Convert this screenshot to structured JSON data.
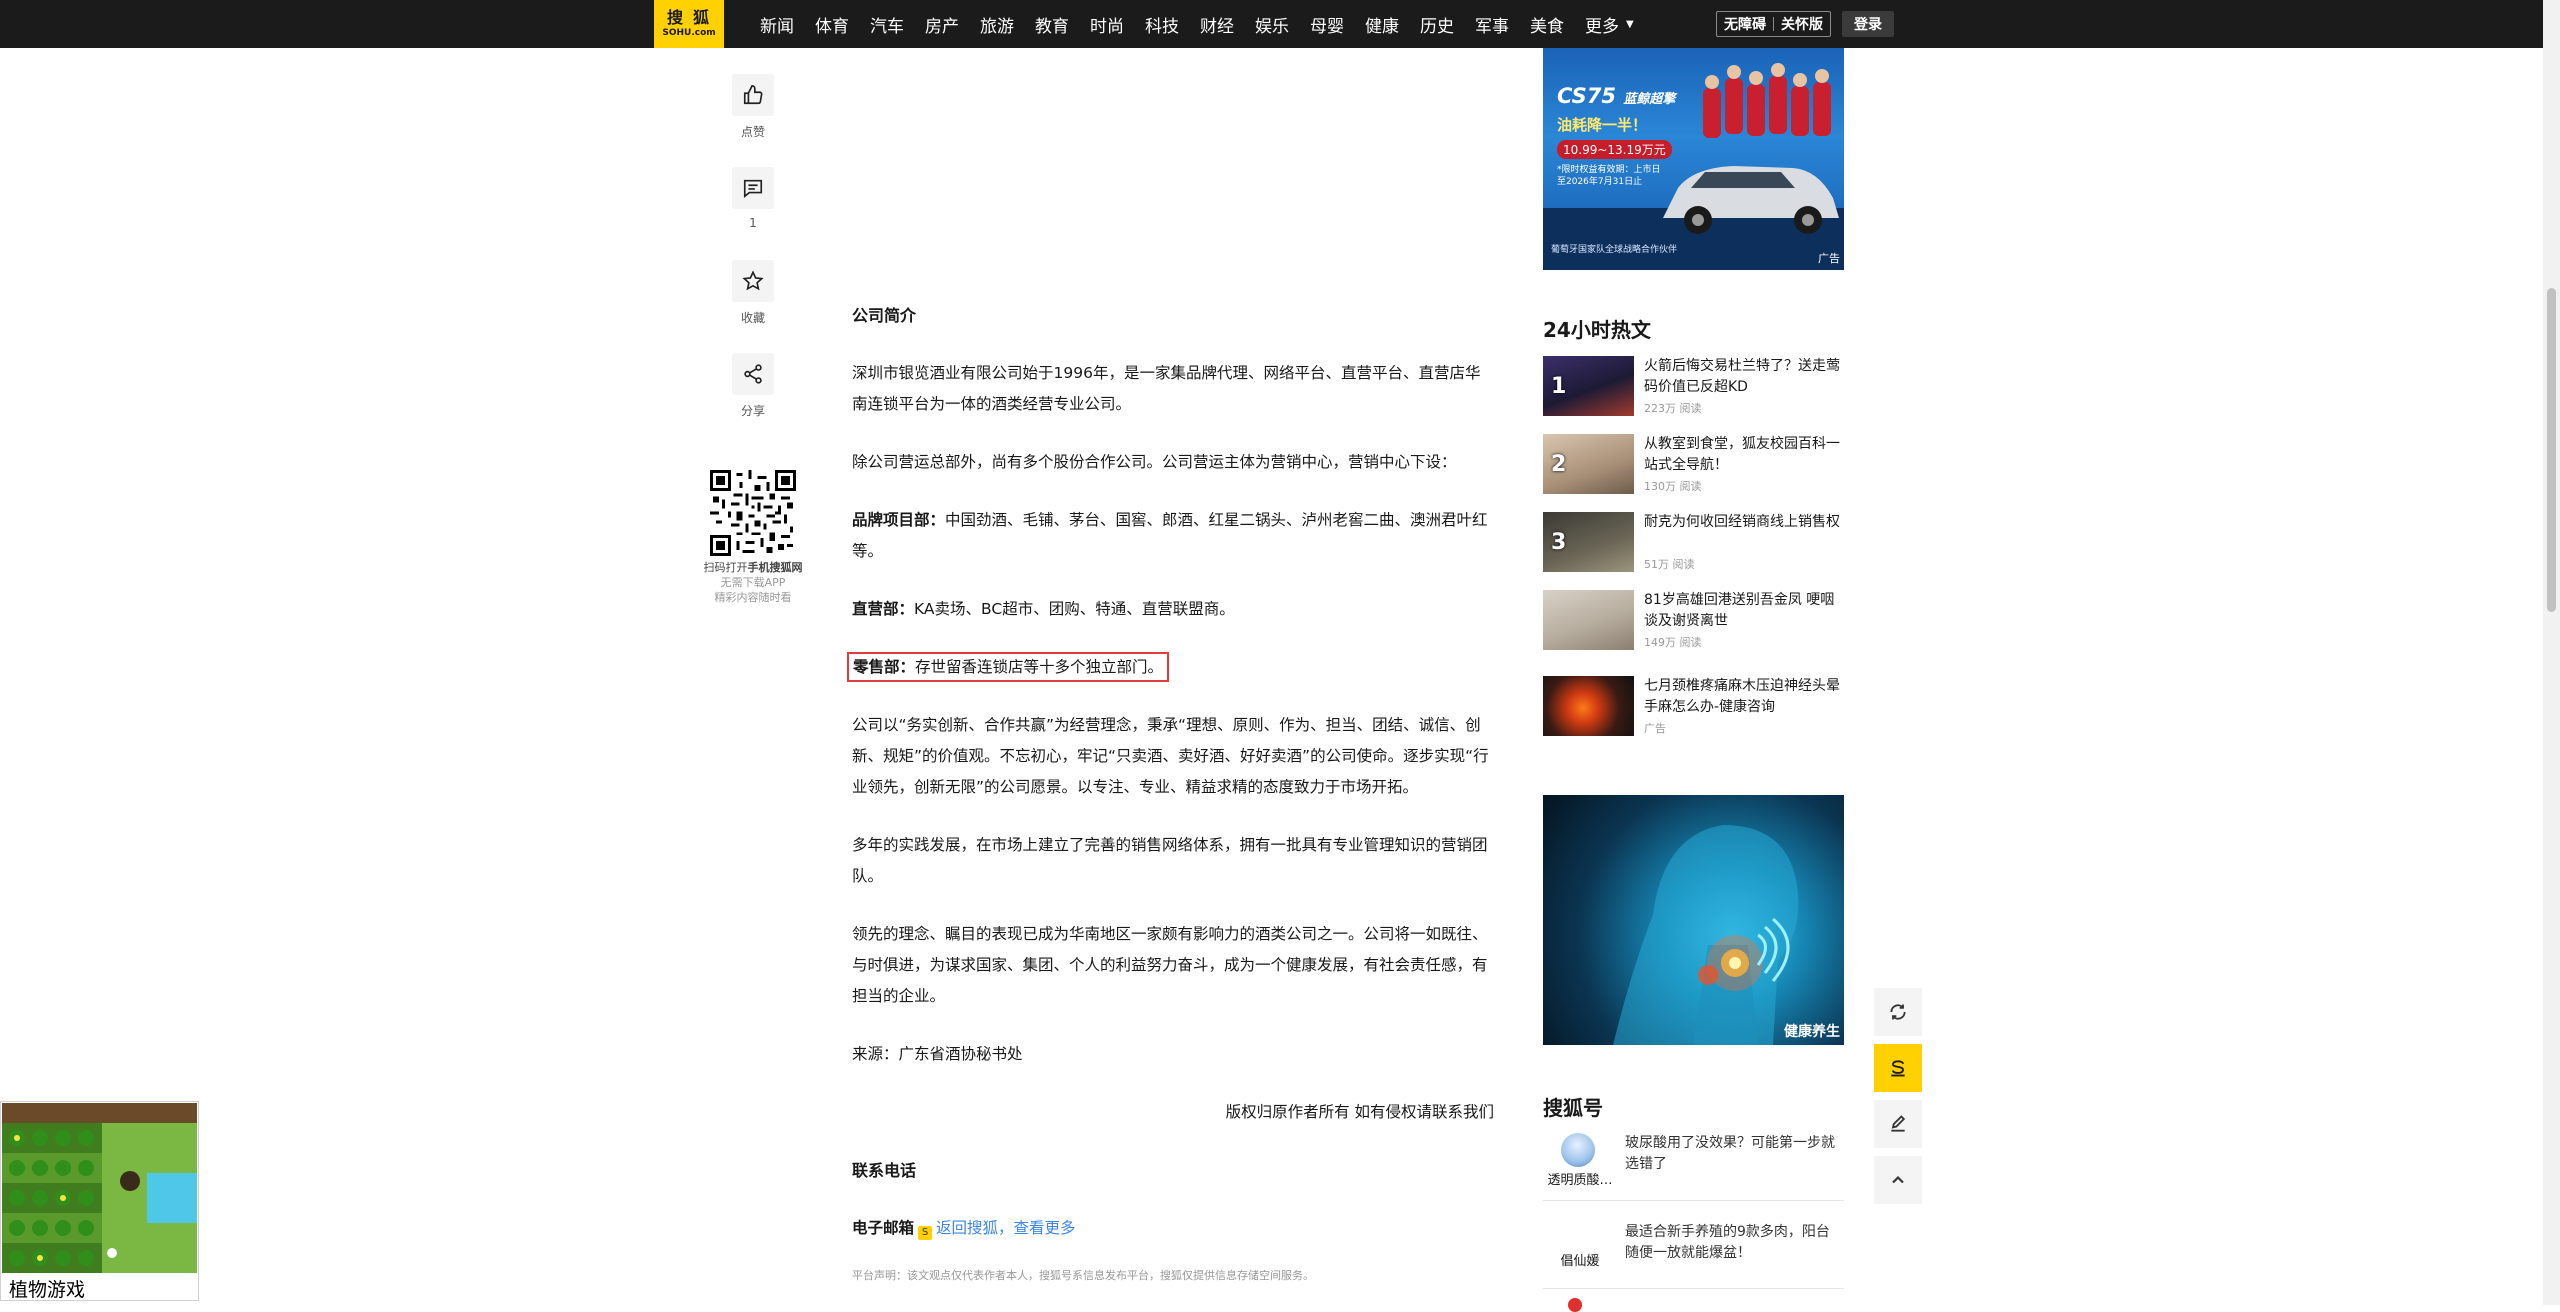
{
  "nav": {
    "logo_top": "搜狐",
    "logo_bottom": "SOHU.com",
    "items": [
      "新闻",
      "体育",
      "汽车",
      "房产",
      "旅游",
      "教育",
      "时尚",
      "科技",
      "财经",
      "娱乐",
      "母婴",
      "健康",
      "历史",
      "军事",
      "美食"
    ],
    "more": "更多",
    "accessibility": "无障碍",
    "elder": "关怀版",
    "login": "登录"
  },
  "tools": {
    "like": "点赞",
    "comment_count": "1",
    "favorite": "收藏",
    "share": "分享"
  },
  "qr": {
    "line1_prefix": "扫码打开",
    "line1_bold": "手机搜狐网",
    "line2": "无需下载APP",
    "line3": "精彩内容随时看"
  },
  "article": {
    "intro_heading": "公司简介",
    "p1": "深圳市银览酒业有限公司始于1996年，是一家集品牌代理、网络平台、直营平台、直营店华南连锁平台为一体的酒类经营专业公司。",
    "p2": "除公司营运总部外，尚有多个股份合作公司。公司营运主体为营销中心，营销中心下设：",
    "brand_label": "品牌项目部：",
    "brand_text": "中国劲酒、毛铺、茅台、国窖、郎酒、红星二锅头、泸州老窖二曲、澳洲君叶红等。",
    "direct_label": "直营部：",
    "direct_text": "KA卖场、BC超市、团购、特通、直营联盟商。",
    "retail_label": "零售部：",
    "retail_text": "存世留香连锁店等十多个独立部门。",
    "p3": "公司以“务实创新、合作共赢”为经营理念，秉承“理想、原则、作为、担当、团结、诚信、创新、规矩”的价值观。不忘初心，牢记“只卖酒、卖好酒、好好卖酒”的公司使命。逐步实现“行业领先，创新无限”的公司愿景。以专注、专业、精益求精的态度致力于市场开拓。",
    "p4": "多年的实践发展，在市场上建立了完善的销售网络体系，拥有一批具有专业管理知识的营销团队。",
    "p5": "领先的理念、瞩目的表现已成为华南地区一家颇有影响力的酒类公司之一。公司将一如既往、与时俱进，为谋求国家、集团、个人的利益努力奋斗，成为一个健康发展，有社会责任感，有担当的企业。",
    "source": "来源：广东省酒协秘书处",
    "copyright": "版权归原作者所有 如有侵权请联系我们",
    "contact_heading": "联系电话",
    "email_label": "电子邮箱",
    "back_link": "返回搜狐，查看更多",
    "disclaimer": "平台声明：该文观点仅代表作者本人，搜狐号系信息发布平台，搜狐仅提供信息存储空间服务。"
  },
  "ad_top": {
    "model": "CS75",
    "slogan_small": "蓝鲸超擎",
    "headline": "油耗降一半！",
    "date": "10.99~13.19万元",
    "fine_print": "*限时权益有效期：上市日至2026年7月31日止",
    "bottom": "葡萄牙国家队全球战略合作伙伴",
    "tag": "广告"
  },
  "hot": {
    "title": "24小时热文",
    "items": [
      {
        "num": "1",
        "title": "火箭后悔交易杜兰特了？送走莺码价值已反超KD",
        "meta": "223万 阅读"
      },
      {
        "num": "2",
        "title": "从教室到食堂，狐友校园百科一站式全导航！",
        "meta": "130万 阅读"
      },
      {
        "num": "3",
        "title": "耐克为何收回经销商线上销售权",
        "meta": "51万 阅读"
      },
      {
        "num": "",
        "title": "81岁高雄回港送别吾金凤 哽咽谈及谢贤离世",
        "meta": "149万 阅读"
      },
      {
        "num": "",
        "title": "七月颈椎疼痛麻木压迫神经头晕手麻怎么办-健康咨询",
        "meta": "广告"
      }
    ]
  },
  "ad_mid": {
    "caption": "健康养生"
  },
  "sohuhao": {
    "title": "搜狐号",
    "items": [
      {
        "name": "透明质酸…",
        "title": "玻尿酸用了没效果？可能第一步就选错了"
      },
      {
        "name": "倡仙媛",
        "title": "最适合新手养殖的9款多肉，阳台随便一放就能爆盆！"
      }
    ]
  },
  "game": {
    "label": "植物游戏"
  },
  "colors": {
    "brand_yellow": "#ffd100",
    "nav_bg": "#1b1b1b",
    "link_blue": "#3e86e8",
    "highlight_red": "#e23b3b"
  }
}
